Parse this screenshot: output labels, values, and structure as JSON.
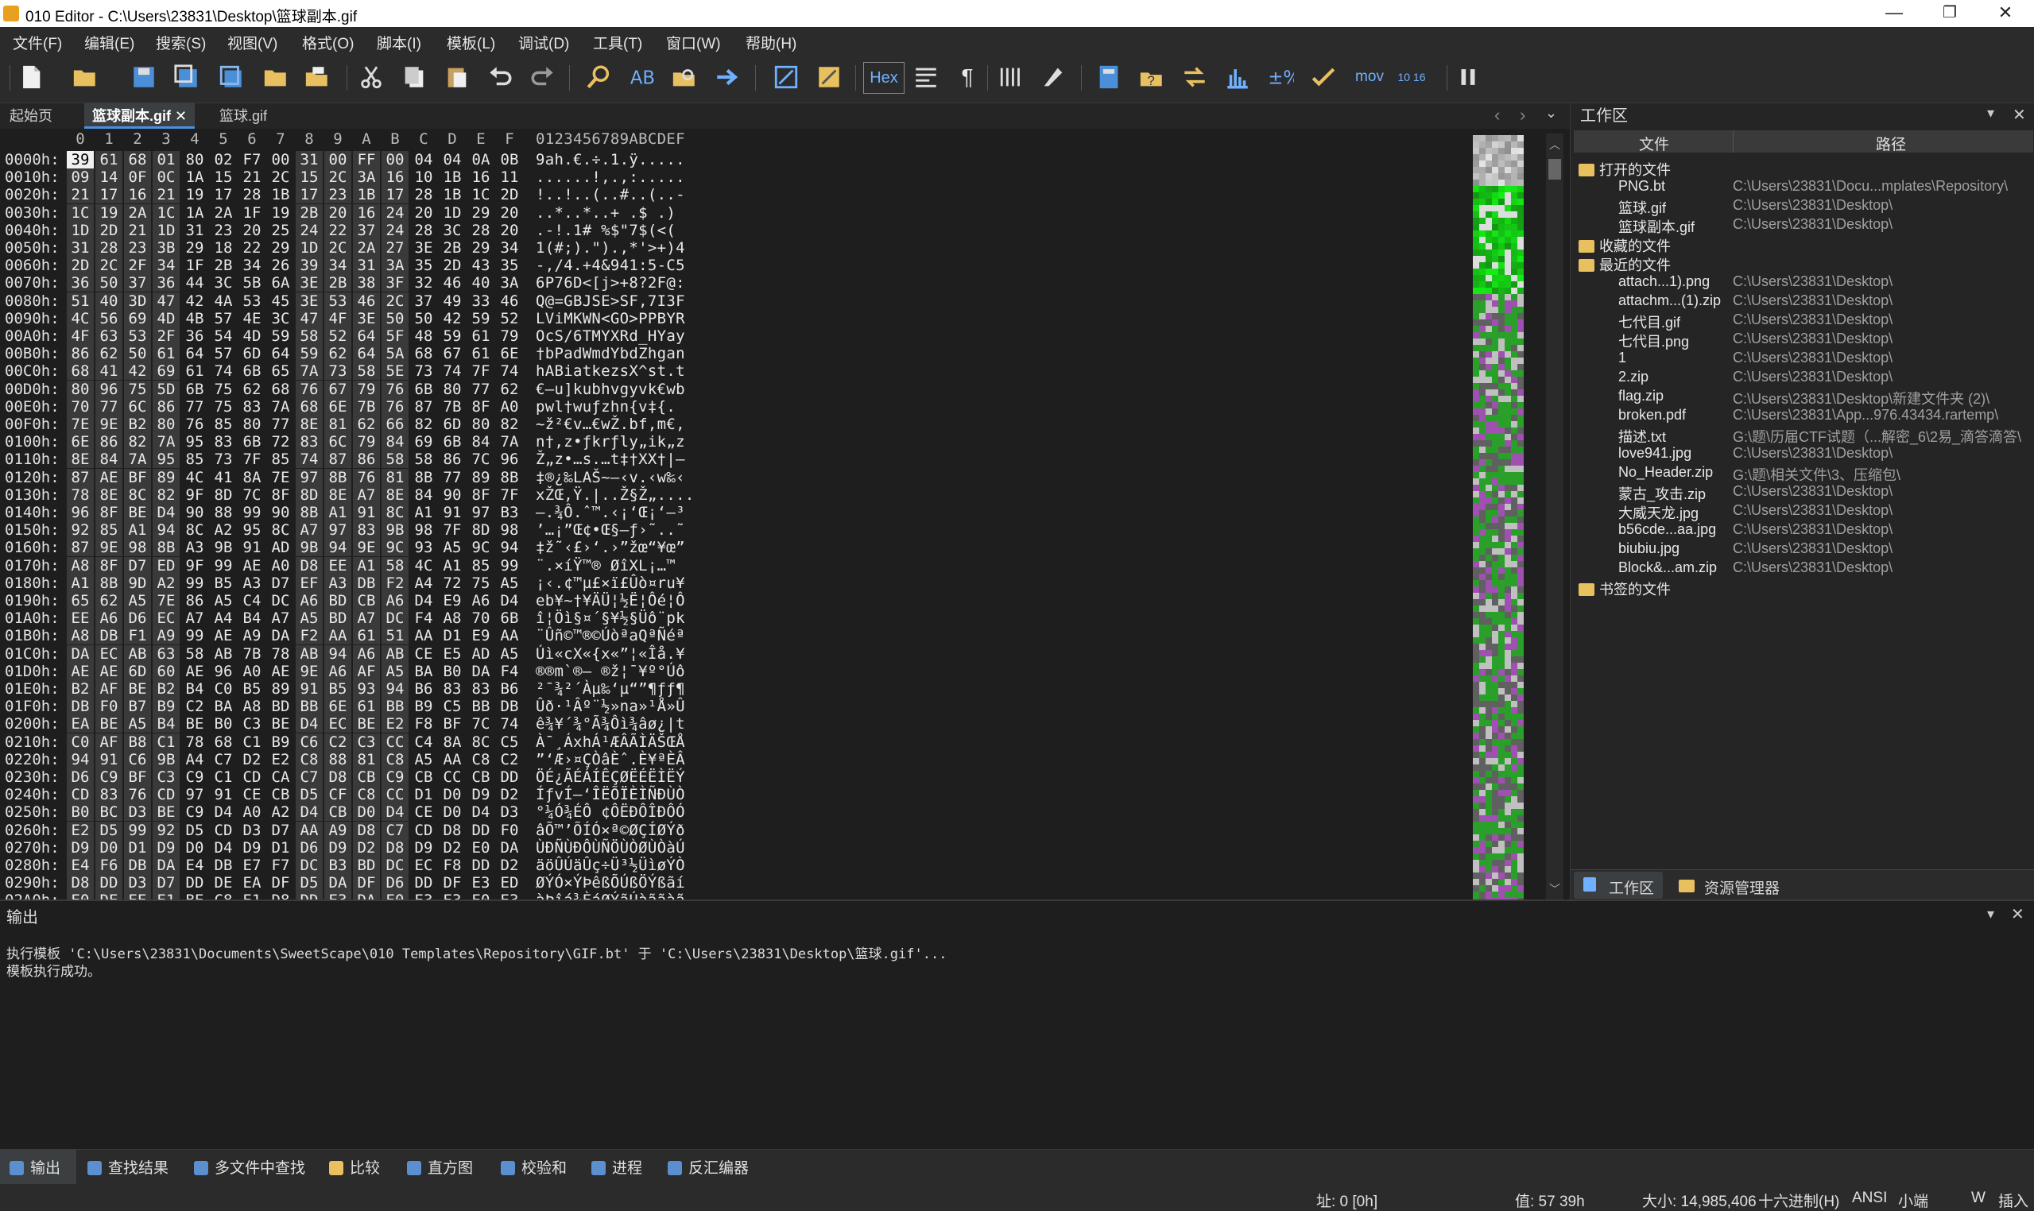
{
  "title": "010 Editor - C:\\Users\\23831\\Desktop\\篮球副本.gif",
  "window": {
    "min": "—",
    "max": "❐",
    "close": "✕"
  },
  "menu": [
    "文件(F)",
    "编辑(E)",
    "搜索(S)",
    "视图(V)",
    "格式(O)",
    "脚本(I)",
    "模板(L)",
    "调试(D)",
    "工具(T)",
    "窗口(W)",
    "帮助(H)"
  ],
  "toolbar": {
    "hex_label": "Hex",
    "mov_label": "mov",
    "num_label": "10 16"
  },
  "tabs": {
    "start": "起始页",
    "active": "篮球副本.gif",
    "close": "✕",
    "other": "篮球.gif"
  },
  "hex": {
    "col_headers": [
      "0",
      "1",
      "2",
      "3",
      "4",
      "5",
      "6",
      "7",
      "8",
      "9",
      "A",
      "B",
      "C",
      "D",
      "E",
      "F"
    ],
    "ascii_header": "0123456789ABCDEF",
    "rows": [
      {
        "addr": "0000h:",
        "bytes": [
          "39",
          "61",
          "68",
          "01",
          "80",
          "02",
          "F7",
          "00",
          "31",
          "00",
          "FF",
          "00",
          "04",
          "04",
          "0A",
          "0B"
        ],
        "ascii": "9ah.€.÷.1.ÿ....."
      },
      {
        "addr": "0010h:",
        "bytes": [
          "09",
          "14",
          "0F",
          "0C",
          "1A",
          "15",
          "21",
          "2C",
          "15",
          "2C",
          "3A",
          "16",
          "10",
          "1B",
          "16",
          "11"
        ],
        "ascii": "......!,.,:....."
      },
      {
        "addr": "0020h:",
        "bytes": [
          "21",
          "17",
          "16",
          "21",
          "19",
          "17",
          "28",
          "1B",
          "17",
          "23",
          "1B",
          "17",
          "28",
          "1B",
          "1C",
          "2D"
        ],
        "ascii": "!..!..(..#..(..-"
      },
      {
        "addr": "0030h:",
        "bytes": [
          "1C",
          "19",
          "2A",
          "1C",
          "1A",
          "2A",
          "1F",
          "19",
          "2B",
          "20",
          "16",
          "24",
          "20",
          "1D",
          "29",
          "20"
        ],
        "ascii": "..*..*..+ .$ .) "
      },
      {
        "addr": "0040h:",
        "bytes": [
          "1D",
          "2D",
          "21",
          "1D",
          "31",
          "23",
          "20",
          "25",
          "24",
          "22",
          "37",
          "24",
          "28",
          "3C",
          "28",
          "20"
        ],
        "ascii": ".-!.1# %$\"7$(<( "
      },
      {
        "addr": "0050h:",
        "bytes": [
          "31",
          "28",
          "23",
          "3B",
          "29",
          "18",
          "22",
          "29",
          "1D",
          "2C",
          "2A",
          "27",
          "3E",
          "2B",
          "29",
          "34"
        ],
        "ascii": "1(#;).\").,*'>+)4"
      },
      {
        "addr": "0060h:",
        "bytes": [
          "2D",
          "2C",
          "2F",
          "34",
          "1F",
          "2B",
          "34",
          "26",
          "39",
          "34",
          "31",
          "3A",
          "35",
          "2D",
          "43",
          "35"
        ],
        "ascii": "-,/4.+4&941:5-C5"
      },
      {
        "addr": "0070h:",
        "bytes": [
          "36",
          "50",
          "37",
          "36",
          "44",
          "3C",
          "5B",
          "6A",
          "3E",
          "2B",
          "38",
          "3F",
          "32",
          "46",
          "40",
          "3A"
        ],
        "ascii": "6P76D<[j>+8?2F@:"
      },
      {
        "addr": "0080h:",
        "bytes": [
          "51",
          "40",
          "3D",
          "47",
          "42",
          "4A",
          "53",
          "45",
          "3E",
          "53",
          "46",
          "2C",
          "37",
          "49",
          "33",
          "46"
        ],
        "ascii": "Q@=GBJSE>SF,7I3F"
      },
      {
        "addr": "0090h:",
        "bytes": [
          "4C",
          "56",
          "69",
          "4D",
          "4B",
          "57",
          "4E",
          "3C",
          "47",
          "4F",
          "3E",
          "50",
          "50",
          "42",
          "59",
          "52"
        ],
        "ascii": "LViMKWN<GO>PPBYR"
      },
      {
        "addr": "00A0h:",
        "bytes": [
          "4F",
          "63",
          "53",
          "2F",
          "36",
          "54",
          "4D",
          "59",
          "58",
          "52",
          "64",
          "5F",
          "48",
          "59",
          "61",
          "79"
        ],
        "ascii": "OcS/6TMYXRd_HYay"
      },
      {
        "addr": "00B0h:",
        "bytes": [
          "86",
          "62",
          "50",
          "61",
          "64",
          "57",
          "6D",
          "64",
          "59",
          "62",
          "64",
          "5A",
          "68",
          "67",
          "61",
          "6E"
        ],
        "ascii": "†bPadWmdYbdZhgan"
      },
      {
        "addr": "00C0h:",
        "bytes": [
          "68",
          "41",
          "42",
          "69",
          "61",
          "74",
          "6B",
          "65",
          "7A",
          "73",
          "58",
          "5E",
          "73",
          "74",
          "7F",
          "74"
        ],
        "ascii": "hABiatkezsX^st.t"
      },
      {
        "addr": "00D0h:",
        "bytes": [
          "80",
          "96",
          "75",
          "5D",
          "6B",
          "75",
          "62",
          "68",
          "76",
          "67",
          "79",
          "76",
          "6B",
          "80",
          "77",
          "62"
        ],
        "ascii": "€–u]kubhvgyvk€wb"
      },
      {
        "addr": "00E0h:",
        "bytes": [
          "70",
          "77",
          "6C",
          "86",
          "77",
          "75",
          "83",
          "7A",
          "68",
          "6E",
          "7B",
          "76",
          "87",
          "7B",
          "8F",
          "A0"
        ],
        "ascii": "pwl†wuƒzhn{v‡{. "
      },
      {
        "addr": "00F0h:",
        "bytes": [
          "7E",
          "9E",
          "B2",
          "80",
          "76",
          "85",
          "80",
          "77",
          "8E",
          "81",
          "62",
          "66",
          "82",
          "6D",
          "80",
          "82"
        ],
        "ascii": "~ž²€v…€wŽ.bf‚m€‚"
      },
      {
        "addr": "0100h:",
        "bytes": [
          "6E",
          "86",
          "82",
          "7A",
          "95",
          "83",
          "6B",
          "72",
          "83",
          "6C",
          "79",
          "84",
          "69",
          "6B",
          "84",
          "7A"
        ],
        "ascii": "n†‚z•ƒkrƒly„ik„z"
      },
      {
        "addr": "0110h:",
        "bytes": [
          "8E",
          "84",
          "7A",
          "95",
          "85",
          "73",
          "7F",
          "85",
          "74",
          "87",
          "86",
          "58",
          "58",
          "86",
          "7C",
          "96"
        ],
        "ascii": "Ž„z•…s.…t‡†XX†|–"
      },
      {
        "addr": "0120h:",
        "bytes": [
          "87",
          "AE",
          "BF",
          "89",
          "4C",
          "41",
          "8A",
          "7E",
          "97",
          "8B",
          "76",
          "81",
          "8B",
          "77",
          "89",
          "8B"
        ],
        "ascii": "‡®¿‰LAŠ~—‹v.‹w‰‹"
      },
      {
        "addr": "0130h:",
        "bytes": [
          "78",
          "8E",
          "8C",
          "82",
          "9F",
          "8D",
          "7C",
          "8F",
          "8D",
          "8E",
          "A7",
          "8E",
          "84",
          "90",
          "8F",
          "7F"
        ],
        "ascii": "xŽŒ‚Ÿ.|..Ž§Ž„...."
      },
      {
        "addr": "0140h:",
        "bytes": [
          "96",
          "8F",
          "BE",
          "D4",
          "90",
          "88",
          "99",
          "90",
          "8B",
          "A1",
          "91",
          "8C",
          "A1",
          "91",
          "97",
          "B3"
        ],
        "ascii": "–.¾Ô.ˆ™.‹¡‘Œ¡‘—³"
      },
      {
        "addr": "0150h:",
        "bytes": [
          "92",
          "85",
          "A1",
          "94",
          "8C",
          "A2",
          "95",
          "8C",
          "A7",
          "97",
          "83",
          "9B",
          "98",
          "7F",
          "8D",
          "98"
        ],
        "ascii": "’…¡”Œ¢•Œ§—ƒ›˜..˜"
      },
      {
        "addr": "0160h:",
        "bytes": [
          "87",
          "9E",
          "98",
          "8B",
          "A3",
          "9B",
          "91",
          "AD",
          "9B",
          "94",
          "9E",
          "9C",
          "93",
          "A5",
          "9C",
          "94"
        ],
        "ascii": "‡ž˜‹£›‘.›”žœ“¥œ”"
      },
      {
        "addr": "0170h:",
        "bytes": [
          "A8",
          "8F",
          "D7",
          "ED",
          "9F",
          "99",
          "AE",
          "A0",
          "D8",
          "EE",
          "A1",
          "58",
          "4C",
          "A1",
          "85",
          "99"
        ],
        "ascii": "¨.×íŸ™® ØîXL¡…™"
      },
      {
        "addr": "0180h:",
        "bytes": [
          "A1",
          "8B",
          "9D",
          "A2",
          "99",
          "B5",
          "A3",
          "D7",
          "EF",
          "A3",
          "DB",
          "F2",
          "A4",
          "72",
          "75",
          "A5"
        ],
        "ascii": "¡‹.¢™µ£×ï£Ûò¤ru¥"
      },
      {
        "addr": "0190h:",
        "bytes": [
          "65",
          "62",
          "A5",
          "7E",
          "86",
          "A5",
          "C4",
          "DC",
          "A6",
          "BD",
          "CB",
          "A6",
          "D4",
          "E9",
          "A6",
          "D4"
        ],
        "ascii": "eb¥~†¥ÄÜ¦½Ë¦Ôé¦Ô"
      },
      {
        "addr": "01A0h:",
        "bytes": [
          "EE",
          "A6",
          "D6",
          "EC",
          "A7",
          "A4",
          "B4",
          "A7",
          "A5",
          "BD",
          "A7",
          "DC",
          "F4",
          "A8",
          "70",
          "6B"
        ],
        "ascii": "î¦Öì§¤´§¥½§Üô¨pk"
      },
      {
        "addr": "01B0h:",
        "bytes": [
          "A8",
          "DB",
          "F1",
          "A9",
          "99",
          "AE",
          "A9",
          "DA",
          "F2",
          "AA",
          "61",
          "51",
          "AA",
          "D1",
          "E9",
          "AA"
        ],
        "ascii": "¨Ûñ©™®©ÚòªaQªÑéª"
      },
      {
        "addr": "01C0h:",
        "bytes": [
          "DA",
          "EC",
          "AB",
          "63",
          "58",
          "AB",
          "7B",
          "78",
          "AB",
          "94",
          "A6",
          "AB",
          "CE",
          "E5",
          "AD",
          "A5"
        ],
        "ascii": "Úì«cX«{x«”¦«Îå.¥"
      },
      {
        "addr": "01D0h:",
        "bytes": [
          "AE",
          "AE",
          "6D",
          "60",
          "AE",
          "96",
          "A0",
          "AE",
          "9E",
          "A6",
          "AF",
          "A5",
          "BA",
          "B0",
          "DA",
          "F4"
        ],
        "ascii": "®®m`®– ®ž¦¯¥º°Úô"
      },
      {
        "addr": "01E0h:",
        "bytes": [
          "B2",
          "AF",
          "BE",
          "B2",
          "B4",
          "C0",
          "B5",
          "89",
          "91",
          "B5",
          "93",
          "94",
          "B6",
          "83",
          "83",
          "B6"
        ],
        "ascii": "²¯¾²´Àµ‰‘µ“”¶ƒƒ¶"
      },
      {
        "addr": "01F0h:",
        "bytes": [
          "DB",
          "F0",
          "B7",
          "B9",
          "C2",
          "BA",
          "A8",
          "BD",
          "BB",
          "6E",
          "61",
          "BB",
          "B9",
          "C5",
          "BB",
          "DB"
        ],
        "ascii": "Ûð·¹Âº¨½»na»¹Å»Û"
      },
      {
        "addr": "0200h:",
        "bytes": [
          "EA",
          "BE",
          "A5",
          "B4",
          "BE",
          "B0",
          "C3",
          "BE",
          "D4",
          "EC",
          "BE",
          "E2",
          "F8",
          "BF",
          "7C",
          "74"
        ],
        "ascii": "ê¾¥´¾°Ã¾Ôì¾âø¿|t"
      },
      {
        "addr": "0210h:",
        "bytes": [
          "C0",
          "AF",
          "B8",
          "C1",
          "78",
          "68",
          "C1",
          "B9",
          "C6",
          "C2",
          "C3",
          "CC",
          "C4",
          "8A",
          "8C",
          "C5"
        ],
        "ascii": "À¯¸ÁxhÁ¹ÆÂÃÌÄŠŒÅ"
      },
      {
        "addr": "0220h:",
        "bytes": [
          "94",
          "91",
          "C6",
          "9B",
          "A4",
          "C7",
          "D2",
          "E2",
          "C8",
          "88",
          "81",
          "C8",
          "A5",
          "AA",
          "C8",
          "C2"
        ],
        "ascii": "”‘Æ›¤ÇÒâÈˆ.È¥ªÈÂ"
      },
      {
        "addr": "0230h:",
        "bytes": [
          "D6",
          "C9",
          "BF",
          "C3",
          "C9",
          "C1",
          "CD",
          "CA",
          "C7",
          "D8",
          "CB",
          "C9",
          "CB",
          "CC",
          "CB",
          "DD"
        ],
        "ascii": "ÖÉ¿ÃÉÁÍÊÇØËÉËÌËÝ"
      },
      {
        "addr": "0240h:",
        "bytes": [
          "CD",
          "83",
          "76",
          "CD",
          "97",
          "91",
          "CE",
          "CB",
          "D5",
          "CF",
          "C8",
          "CC",
          "D1",
          "D0",
          "D9",
          "D2"
        ],
        "ascii": "ÍƒvÍ—‘ÎËÕÏÈÌÑÐÙÒ"
      },
      {
        "addr": "0250h:",
        "bytes": [
          "B0",
          "BC",
          "D3",
          "BE",
          "C9",
          "D4",
          "A0",
          "A2",
          "D4",
          "CB",
          "D0",
          "D4",
          "CE",
          "D0",
          "D4",
          "D3"
        ],
        "ascii": "°¼Ó¾ÉÔ ¢ÔËÐÔÎÐÔÓ"
      },
      {
        "addr": "0260h:",
        "bytes": [
          "E2",
          "D5",
          "99",
          "92",
          "D5",
          "CD",
          "D3",
          "D7",
          "AA",
          "A9",
          "D8",
          "C7",
          "CD",
          "D8",
          "DD",
          "F0"
        ],
        "ascii": "âÕ™’ÕÍÓ×ª©ØÇÍØÝð"
      },
      {
        "addr": "0270h:",
        "bytes": [
          "D9",
          "D0",
          "D1",
          "D9",
          "D0",
          "D4",
          "D9",
          "D1",
          "D6",
          "D9",
          "D2",
          "D8",
          "D9",
          "D2",
          "E0",
          "DA"
        ],
        "ascii": "ÙÐÑÙÐÔÙÑÖÙÒØÙÒàÚ"
      },
      {
        "addr": "0280h:",
        "bytes": [
          "E4",
          "F6",
          "DB",
          "DA",
          "E4",
          "DB",
          "E7",
          "F7",
          "DC",
          "B3",
          "BD",
          "DC",
          "EC",
          "F8",
          "DD",
          "D2"
        ],
        "ascii": "äöÛÚäÛç÷Ü³½ÜìøÝÒ"
      },
      {
        "addr": "0290h:",
        "bytes": [
          "D8",
          "DD",
          "D3",
          "D7",
          "DD",
          "DE",
          "EA",
          "DF",
          "D5",
          "DA",
          "DF",
          "D6",
          "DD",
          "DF",
          "E3",
          "ED"
        ],
        "ascii": "ØÝÓ×ÝÞêßÕÚßÖÝßãí"
      },
      {
        "addr": "02A0h:",
        "bytes": [
          "E0",
          "DE",
          "EE",
          "E1",
          "BE",
          "C8",
          "E1",
          "D8",
          "DD",
          "E3",
          "DA",
          "E0",
          "E3",
          "E3",
          "E0",
          "E3"
        ],
        "ascii": "àÞîá¾ÈáØÝãÚàããàã"
      }
    ]
  },
  "workspace": {
    "title": "工作区",
    "col_file": "文件",
    "col_path": "路径",
    "groups": {
      "open": "打开的文件",
      "favorites": "收藏的文件",
      "recent": "最近的文件",
      "bookmarked": "书签的文件"
    },
    "open_files": [
      {
        "name": "PNG.bt",
        "path": "C:\\Users\\23831\\Docu...mplates\\Repository\\"
      },
      {
        "name": "篮球.gif",
        "path": "C:\\Users\\23831\\Desktop\\"
      },
      {
        "name": "篮球副本.gif",
        "path": "C:\\Users\\23831\\Desktop\\"
      }
    ],
    "recent_files": [
      {
        "name": "attach...1).png",
        "path": "C:\\Users\\23831\\Desktop\\"
      },
      {
        "name": "attachm...(1).zip",
        "path": "C:\\Users\\23831\\Desktop\\"
      },
      {
        "name": "七代目.gif",
        "path": "C:\\Users\\23831\\Desktop\\"
      },
      {
        "name": "七代目.png",
        "path": "C:\\Users\\23831\\Desktop\\"
      },
      {
        "name": "1",
        "path": "C:\\Users\\23831\\Desktop\\"
      },
      {
        "name": "2.zip",
        "path": "C:\\Users\\23831\\Desktop\\"
      },
      {
        "name": "flag.zip",
        "path": "C:\\Users\\23831\\Desktop\\新建文件夹 (2)\\"
      },
      {
        "name": "broken.pdf",
        "path": "C:\\Users\\23831\\App...976.43434.rartemp\\"
      },
      {
        "name": "描述.txt",
        "path": "G:\\题\\历届CTF试题（...解密_6\\2易_滴答滴答\\"
      },
      {
        "name": "love941.jpg",
        "path": "C:\\Users\\23831\\Desktop\\"
      },
      {
        "name": "No_Header.zip",
        "path": "G:\\题\\相关文件\\3、压缩包\\"
      },
      {
        "name": "蒙古_攻击.zip",
        "path": "C:\\Users\\23831\\Desktop\\"
      },
      {
        "name": "大威天龙.jpg",
        "path": "C:\\Users\\23831\\Desktop\\"
      },
      {
        "name": "b56cde...aa.jpg",
        "path": "C:\\Users\\23831\\Desktop\\"
      },
      {
        "name": "biubiu.jpg",
        "path": "C:\\Users\\23831\\Desktop\\"
      },
      {
        "name": "Block&...am.zip",
        "path": "C:\\Users\\23831\\Desktop\\"
      }
    ],
    "tab_workspace": "工作区",
    "tab_explorer": "资源管理器"
  },
  "output": {
    "title": "输出",
    "lines": [
      "执行模板 'C:\\Users\\23831\\Documents\\SweetScape\\010 Templates\\Repository\\GIF.bt' 于 'C:\\Users\\23831\\Desktop\\篮球.gif'...",
      "模板执行成功。"
    ]
  },
  "bottom_tabs": [
    "输出",
    "查找结果",
    "多文件中查找",
    "比较",
    "直方图",
    "校验和",
    "进程",
    "反汇编器"
  ],
  "status": {
    "addr": "址: 0 [0h]",
    "value": "值: 57 39h",
    "size": "大小: 14,985,406",
    "mode": "十六进制(H)",
    "encoding": "ANSI",
    "endian": "小端",
    "w": "W",
    "insert": "插入"
  }
}
